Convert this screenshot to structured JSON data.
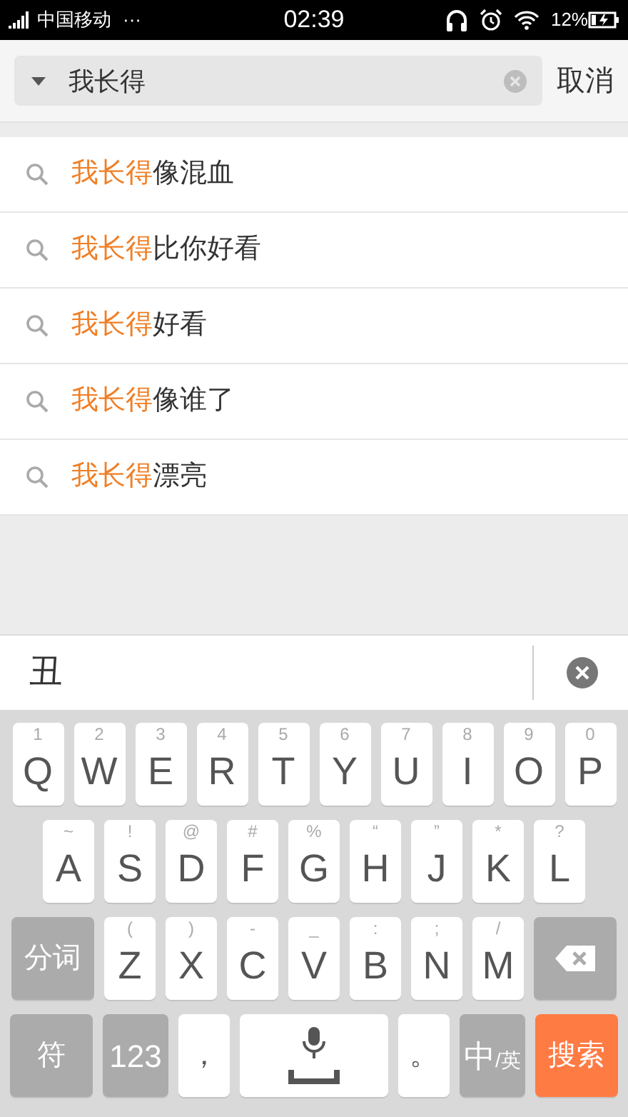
{
  "status_bar": {
    "carrier": "中国移动",
    "more": "···",
    "time": "02:39",
    "battery": "12%"
  },
  "search": {
    "value": "我长得",
    "cancel": "取消"
  },
  "suggestions": [
    {
      "highlight": "我长得",
      "rest": "像混血"
    },
    {
      "highlight": "我长得",
      "rest": "比你好看"
    },
    {
      "highlight": "我长得",
      "rest": "好看"
    },
    {
      "highlight": "我长得",
      "rest": "像谁了"
    },
    {
      "highlight": "我长得",
      "rest": "漂亮"
    }
  ],
  "candidate_bar": {
    "candidate": "丑"
  },
  "keyboard": {
    "rows": [
      {
        "keys": [
          {
            "kind": "letter",
            "label": "Q",
            "hint": "1"
          },
          {
            "kind": "letter",
            "label": "W",
            "hint": "2"
          },
          {
            "kind": "letter",
            "label": "E",
            "hint": "3"
          },
          {
            "kind": "letter",
            "label": "R",
            "hint": "4"
          },
          {
            "kind": "letter",
            "label": "T",
            "hint": "5"
          },
          {
            "kind": "letter",
            "label": "Y",
            "hint": "6"
          },
          {
            "kind": "letter",
            "label": "U",
            "hint": "7"
          },
          {
            "kind": "letter",
            "label": "I",
            "hint": "8"
          },
          {
            "kind": "letter",
            "label": "O",
            "hint": "9"
          },
          {
            "kind": "letter",
            "label": "P",
            "hint": "0"
          }
        ]
      },
      {
        "keys": [
          {
            "kind": "letter",
            "label": "A",
            "hint": "~"
          },
          {
            "kind": "letter",
            "label": "S",
            "hint": "!"
          },
          {
            "kind": "letter",
            "label": "D",
            "hint": "@"
          },
          {
            "kind": "letter",
            "label": "F",
            "hint": "#"
          },
          {
            "kind": "letter",
            "label": "G",
            "hint": "%"
          },
          {
            "kind": "letter",
            "label": "H",
            "hint": "“"
          },
          {
            "kind": "letter",
            "label": "J",
            "hint": "”"
          },
          {
            "kind": "letter",
            "label": "K",
            "hint": "*"
          },
          {
            "kind": "letter",
            "label": "L",
            "hint": "?"
          }
        ]
      },
      {
        "keys": [
          {
            "kind": "function",
            "label": "分词"
          },
          {
            "kind": "letter",
            "label": "Z",
            "hint": "("
          },
          {
            "kind": "letter",
            "label": "X",
            "hint": ")"
          },
          {
            "kind": "letter",
            "label": "C",
            "hint": "-"
          },
          {
            "kind": "letter",
            "label": "V",
            "hint": "_"
          },
          {
            "kind": "letter",
            "label": "B",
            "hint": ":"
          },
          {
            "kind": "letter",
            "label": "N",
            "hint": ";"
          },
          {
            "kind": "letter",
            "label": "M",
            "hint": "/"
          },
          {
            "kind": "backspace"
          }
        ]
      },
      {
        "keys": [
          {
            "kind": "function",
            "label": "符"
          },
          {
            "kind": "mode",
            "label": "123"
          },
          {
            "kind": "punct",
            "label": "，"
          },
          {
            "kind": "space"
          },
          {
            "kind": "punct",
            "label": "。"
          },
          {
            "kind": "mode",
            "label": "中",
            "sub": "/英"
          },
          {
            "kind": "action",
            "label": "搜索"
          }
        ]
      }
    ]
  }
}
